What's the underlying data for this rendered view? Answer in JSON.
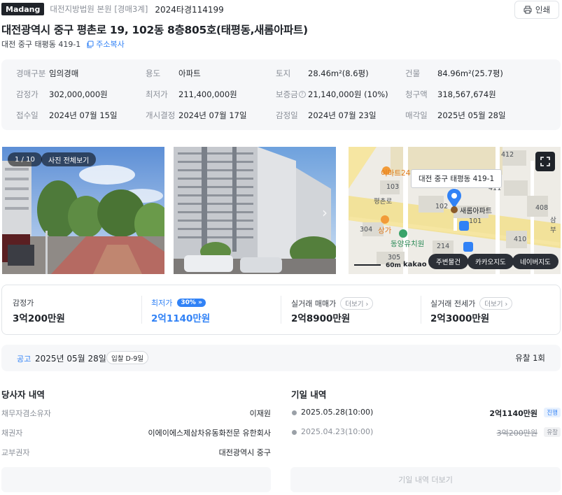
{
  "header": {
    "logo": "Madang",
    "court": "대전지방법원 본원 [경매3계]",
    "case_no": "2024타경114199",
    "print_label": "인쇄"
  },
  "title": "대전광역시 중구 평촌로 19, 102동 8층805호(태평동,새롬아파트)",
  "sub_address": "대전 중구 태평동 419-1",
  "copy_label": "주소복사",
  "info": [
    {
      "k": "경매구분",
      "v": "임의경매"
    },
    {
      "k": "용도",
      "v": "아파트"
    },
    {
      "k": "토지",
      "v": "28.46m²(8.6평)"
    },
    {
      "k": "건물",
      "v": "84.96m²(25.7평)"
    },
    {
      "k": "감정가",
      "v": "302,000,000원"
    },
    {
      "k": "최저가",
      "v": "211,400,000원"
    },
    {
      "k": "보증금",
      "v": "21,140,000원 (10%)"
    },
    {
      "k": "청구액",
      "v": "318,567,674원"
    },
    {
      "k": "접수일",
      "v": "2024년 07월 15일"
    },
    {
      "k": "개시결정",
      "v": "2024년 07월 17일"
    },
    {
      "k": "감정일",
      "v": "2024년 07월 23일"
    },
    {
      "k": "매각일",
      "v": "2025년 05월 28일"
    }
  ],
  "photos": {
    "count": "1 / 10",
    "all_label": "사진 전체보기"
  },
  "map": {
    "popup": "대전 중구 태평동 419-1",
    "building_label": "새롬아파트",
    "labels": [
      "412",
      "103",
      "102",
      "411",
      "408",
      "101",
      "304",
      "214",
      "410",
      "305",
      "평촌로",
      "삼부"
    ],
    "poi_emart": "이마트24",
    "poi_store": "상가",
    "poi_kinder": "동양유치원",
    "scale": "60m",
    "provider": "kakao",
    "btn_nearby": "주변물건",
    "btn_kakao": "카카오지도",
    "btn_naver": "네이버지도"
  },
  "prices": {
    "appraisal_label": "감정가",
    "appraisal_value": "3억200만원",
    "min_label": "최저가",
    "min_pct": "30%",
    "min_value": "2억1140만원",
    "sale_label": "실거래 매매가",
    "sale_value": "2억8900만원",
    "rent_label": "실거래 전세가",
    "rent_value": "2억3000만원",
    "more_label": "더보기"
  },
  "notice": {
    "label": "공고",
    "date": "2025년 05월 28일",
    "dday": "입찰 D-9일",
    "fail_count": "유찰 1회"
  },
  "parties": {
    "title": "당사자 내역",
    "rows": [
      {
        "k": "채무자겸소유자",
        "v": "이재원"
      },
      {
        "k": "채권자",
        "v": "이에이에스제삼차유동화전문 유한회사"
      },
      {
        "k": "교부권자",
        "v": "대전광역시 중구"
      }
    ]
  },
  "history": {
    "title": "기일 내역",
    "rows": [
      {
        "date": "2025.05.28(10:00)",
        "amount": "2억1140만원",
        "status": "진행"
      },
      {
        "date": "2025.04.23(10:00)",
        "amount": "3억200만원",
        "status": "유찰"
      }
    ],
    "more_label": "기일 내역 더보기"
  },
  "colors": {
    "accent": "#3182f6",
    "dark": "#1f2329",
    "muted": "#8a8f98",
    "panel": "#f6f7f9"
  }
}
